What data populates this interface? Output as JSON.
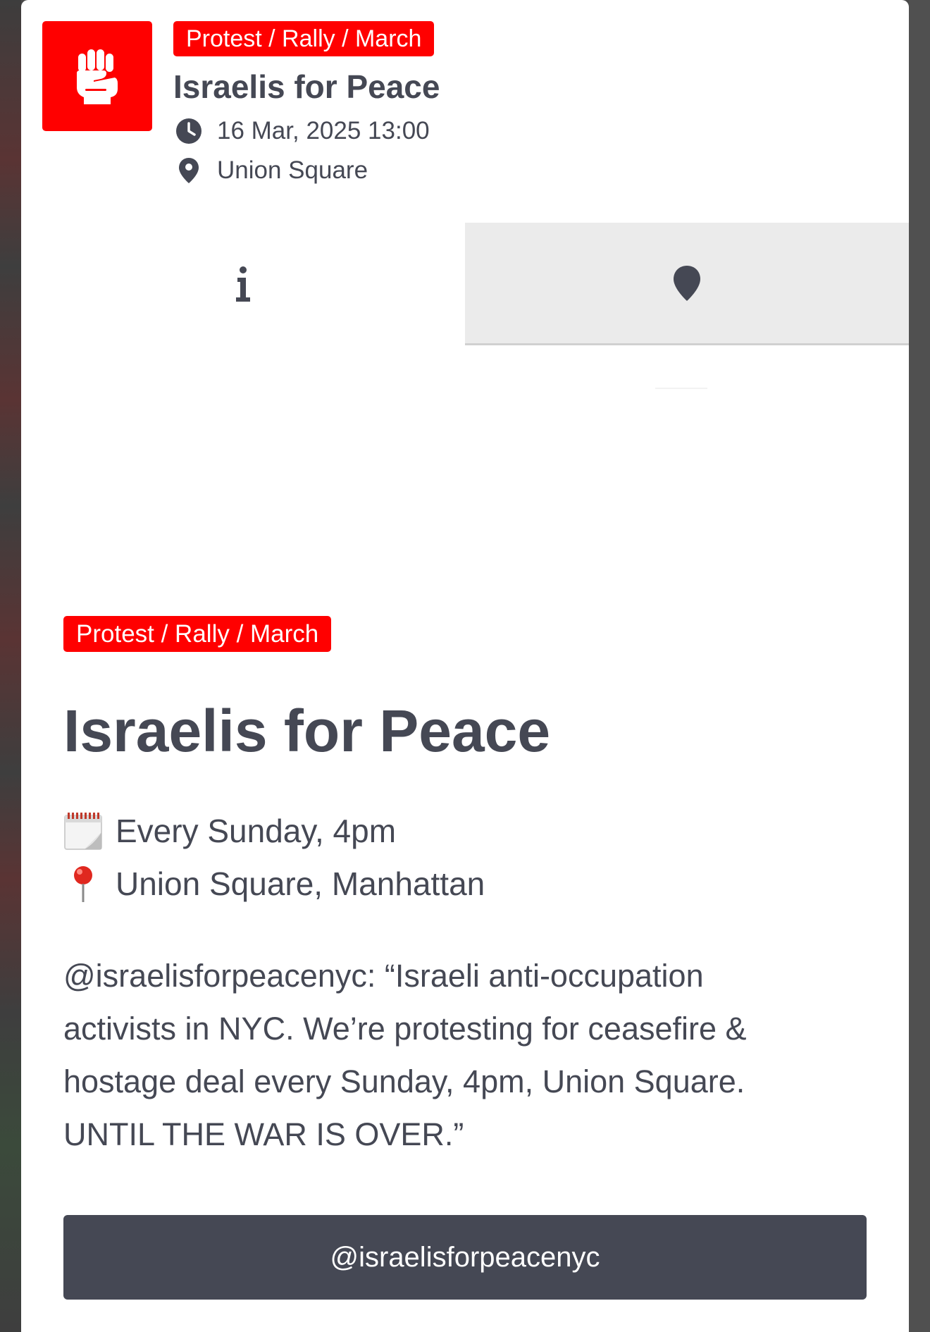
{
  "header": {
    "category_badge": "Protest / Rally / March",
    "title": "Israelis for Peace",
    "datetime": "16 Mar, 2025 13:00",
    "location": "Union Square",
    "logo_icon": "raised-fist-icon",
    "logo_color": "#ff0000"
  },
  "tabs": [
    {
      "icon": "info-icon",
      "active": true
    },
    {
      "icon": "map-pin-icon",
      "active": false
    }
  ],
  "event": {
    "category_badge": "Protest / Rally / March",
    "title": "Israelis for Peace",
    "schedule_emoji": "calendar-emoji",
    "schedule": "Every Sunday, 4pm",
    "place_emoji": "pushpin-emoji",
    "place": "Union Square, Manhattan",
    "description_line1": "@israelisforpeacenyc: “Israeli anti-occupation",
    "description_line2": "activists in NYC. We’re protesting for ceasefire &",
    "description_line3": "hostage deal every Sunday, 4pm, Union Square.",
    "description_line4": "UNTIL THE WAR IS OVER.”",
    "link_button_label": "@israelisforpeacenyc"
  },
  "colors": {
    "accent": "#ff0000",
    "text": "#454854",
    "button": "#454854"
  }
}
